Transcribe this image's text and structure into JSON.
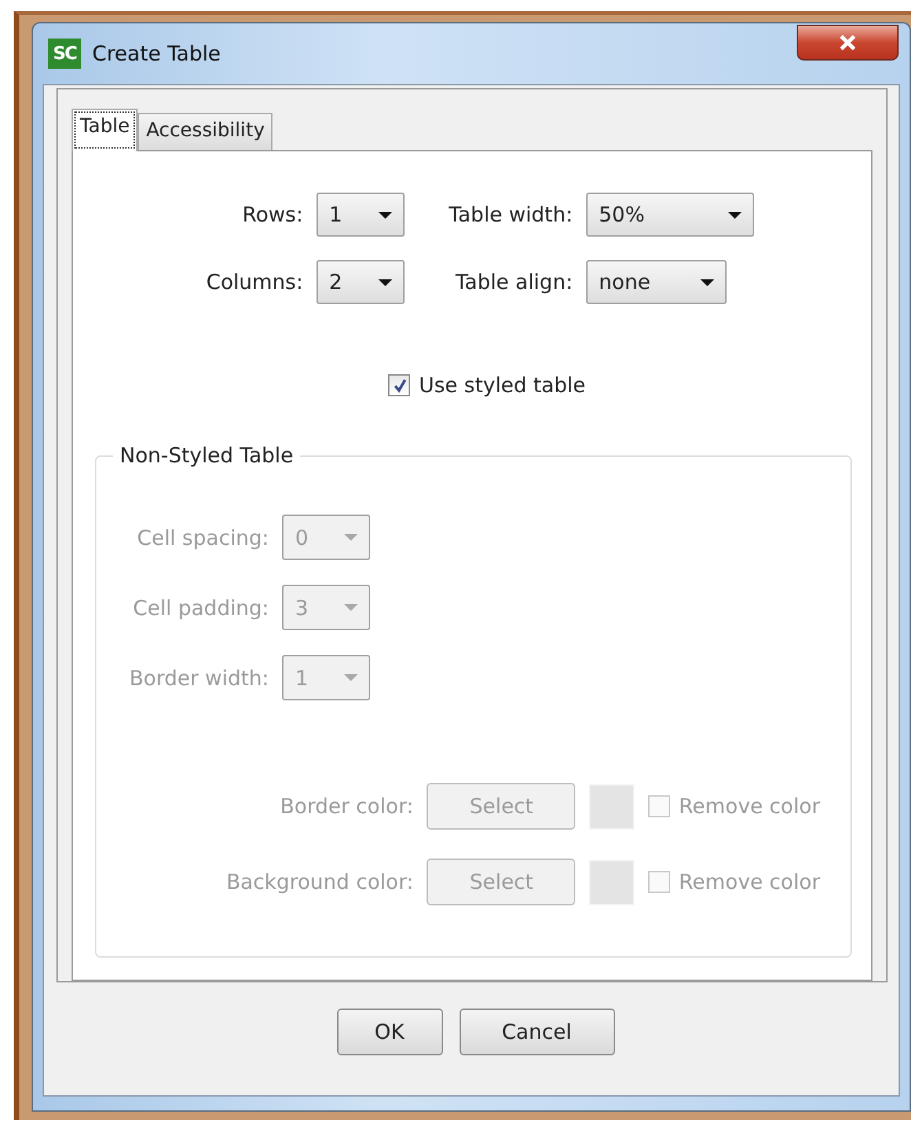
{
  "window": {
    "title": "Create Table",
    "app_icon_text": "SC"
  },
  "tabs": [
    {
      "label": "Table",
      "selected": true
    },
    {
      "label": "Accessibility",
      "selected": false
    }
  ],
  "size_fields": [
    {
      "label": "Rows:",
      "value": "1"
    },
    {
      "label": "Table width:",
      "value": "50%"
    },
    {
      "label": "Columns:",
      "value": "2"
    },
    {
      "label": "Table align:",
      "value": "none"
    }
  ],
  "styled_checkbox": {
    "label": "Use styled table",
    "checked": true
  },
  "non_styled": {
    "legend": "Non-Styled Table",
    "disabled": true,
    "fields": [
      {
        "label": "Cell spacing:",
        "value": "0"
      },
      {
        "label": "Cell padding:",
        "value": "3"
      },
      {
        "label": "Border width:",
        "value": "1"
      }
    ],
    "colors": [
      {
        "label": "Border color:",
        "button": "Select",
        "remove_label": "Remove color",
        "remove_checked": false
      },
      {
        "label": "Background color:",
        "button": "Select",
        "remove_label": "Remove color",
        "remove_checked": false
      }
    ]
  },
  "buttons": [
    "OK",
    "Cancel"
  ]
}
